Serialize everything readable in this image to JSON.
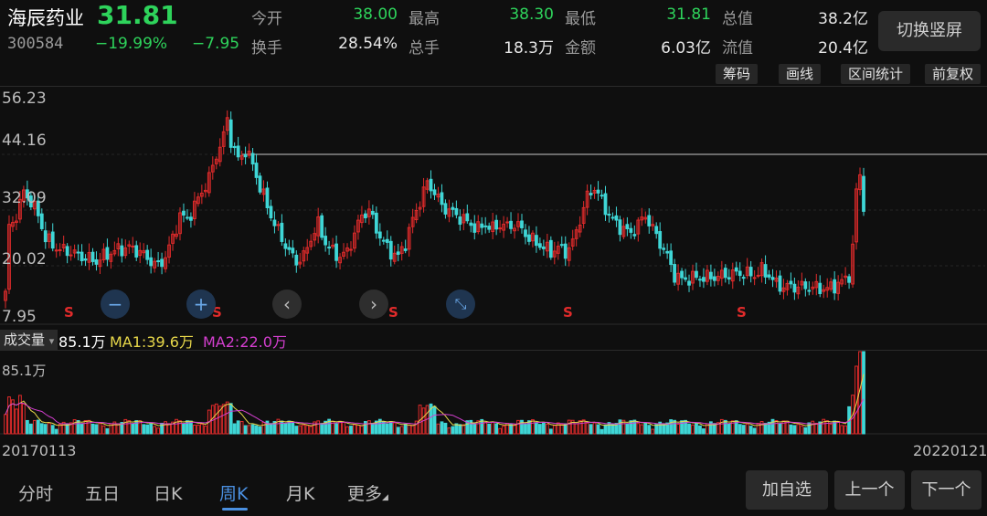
{
  "quote": {
    "name": "海辰药业",
    "price": "31.81",
    "code": "300584",
    "change_pct": "−19.99%",
    "change": "−7.95",
    "fields": [
      {
        "label": "今开",
        "value": "38.00"
      },
      {
        "label": "最高",
        "value": "38.30"
      },
      {
        "label": "最低",
        "value": "31.81"
      },
      {
        "label": "总值",
        "value": "38.2亿"
      },
      {
        "label": "换手",
        "value": "28.54%"
      },
      {
        "label": "总手",
        "value": "18.3万"
      },
      {
        "label": "金额",
        "value": "6.03亿"
      },
      {
        "label": "流值",
        "value": "20.4亿"
      }
    ],
    "switch_label": "切换竖屏"
  },
  "toolbar": {
    "chips": "筹码",
    "draw": "画线",
    "range_stats": "区间统计",
    "adjust": "前复权"
  },
  "chart": {
    "y_labels": [
      "56.23",
      "44.16",
      "32.09",
      "20.02",
      "7.95"
    ],
    "s_marker": "S",
    "start_date": "20170113",
    "end_date": "20220121",
    "colors": {
      "up": "#e02b2b",
      "down": "#3fd6d6",
      "ma1": "#e8d84a",
      "ma2": "#d43fd0"
    }
  },
  "chart_data": {
    "type": "candlestick",
    "period": "weekly",
    "x_range": [
      "20170113",
      "20220121"
    ],
    "ylim": [
      7.95,
      56.23
    ],
    "reference_line": 44.16,
    "last_close": 31.81,
    "price_path": [
      [
        0,
        14.5
      ],
      [
        1,
        28
      ],
      [
        3,
        31
      ],
      [
        5,
        36
      ],
      [
        7,
        34
      ],
      [
        9,
        31
      ],
      [
        11,
        26
      ],
      [
        13,
        24.5
      ],
      [
        15,
        23.5
      ],
      [
        18,
        23
      ],
      [
        21,
        22
      ],
      [
        25,
        21
      ],
      [
        28,
        22.5
      ],
      [
        31,
        23.5
      ],
      [
        34,
        24
      ],
      [
        37,
        23
      ],
      [
        40,
        21
      ],
      [
        42,
        20
      ],
      [
        44,
        22
      ],
      [
        46,
        26
      ],
      [
        48,
        31
      ],
      [
        50,
        30
      ],
      [
        52,
        33
      ],
      [
        54,
        36
      ],
      [
        56,
        39
      ],
      [
        58,
        44
      ],
      [
        60,
        48
      ],
      [
        61,
        52
      ],
      [
        62,
        47
      ],
      [
        64,
        43
      ],
      [
        66,
        45
      ],
      [
        68,
        42
      ],
      [
        70,
        37
      ],
      [
        72,
        33
      ],
      [
        74,
        29
      ],
      [
        76,
        26
      ],
      [
        78,
        23
      ],
      [
        80,
        21
      ],
      [
        82,
        22
      ],
      [
        84,
        26
      ],
      [
        86,
        29
      ],
      [
        88,
        25
      ],
      [
        90,
        23
      ],
      [
        92,
        22
      ],
      [
        94,
        23
      ],
      [
        96,
        27
      ],
      [
        98,
        31
      ],
      [
        100,
        32
      ],
      [
        102,
        28
      ],
      [
        104,
        25
      ],
      [
        106,
        23
      ],
      [
        108,
        22
      ],
      [
        110,
        25
      ],
      [
        112,
        30
      ],
      [
        114,
        34
      ],
      [
        116,
        38
      ],
      [
        118,
        36
      ],
      [
        120,
        33
      ],
      [
        122,
        32
      ],
      [
        124,
        31
      ],
      [
        126,
        30
      ],
      [
        128,
        29
      ],
      [
        130,
        28
      ],
      [
        132,
        29
      ],
      [
        134,
        28
      ],
      [
        136,
        29
      ],
      [
        138,
        28.5
      ],
      [
        140,
        29
      ],
      [
        142,
        28
      ],
      [
        144,
        26
      ],
      [
        146,
        25
      ],
      [
        148,
        24
      ],
      [
        150,
        23
      ],
      [
        152,
        24
      ],
      [
        154,
        23
      ],
      [
        156,
        25
      ],
      [
        158,
        30
      ],
      [
        160,
        35
      ],
      [
        162,
        37
      ],
      [
        164,
        34
      ],
      [
        166,
        31
      ],
      [
        168,
        29
      ],
      [
        170,
        28
      ],
      [
        172,
        27
      ],
      [
        174,
        29
      ],
      [
        176,
        31
      ],
      [
        178,
        28
      ],
      [
        180,
        25
      ],
      [
        182,
        22
      ],
      [
        184,
        18
      ],
      [
        186,
        17
      ],
      [
        190,
        17.5
      ],
      [
        194,
        17.5
      ],
      [
        198,
        18
      ],
      [
        202,
        18.5
      ],
      [
        206,
        18
      ],
      [
        208,
        19
      ],
      [
        210,
        18
      ],
      [
        212,
        16
      ],
      [
        214,
        15.5
      ],
      [
        218,
        15.5
      ],
      [
        222,
        15.3
      ],
      [
        226,
        15
      ],
      [
        230,
        16.5
      ],
      [
        232,
        18
      ],
      [
        233,
        24
      ],
      [
        234,
        36
      ],
      [
        235,
        40
      ],
      [
        236,
        31.81
      ]
    ],
    "volume": {
      "max_label": "85.1万",
      "latest": "85.1万",
      "ma1": "39.6万",
      "ma2": "22.0万"
    }
  },
  "volume_bar": {
    "label": "成交量",
    "dropdown_marker": "▾",
    "value": "85.1万",
    "ma1": "MA1:39.6万",
    "ma2": "MA2:22.0万",
    "max": "85.1万"
  },
  "tabs": [
    "分时",
    "五日",
    "日K",
    "周K",
    "月K",
    "更多"
  ],
  "tab_active": "周K",
  "more_marker": "◢",
  "buttons": {
    "add": "加自选",
    "prev": "上一个",
    "next": "下一个"
  },
  "controls": {
    "zoom_out": "−",
    "zoom_in": "+",
    "left": "‹",
    "right": "›",
    "shrink": "⤡"
  }
}
